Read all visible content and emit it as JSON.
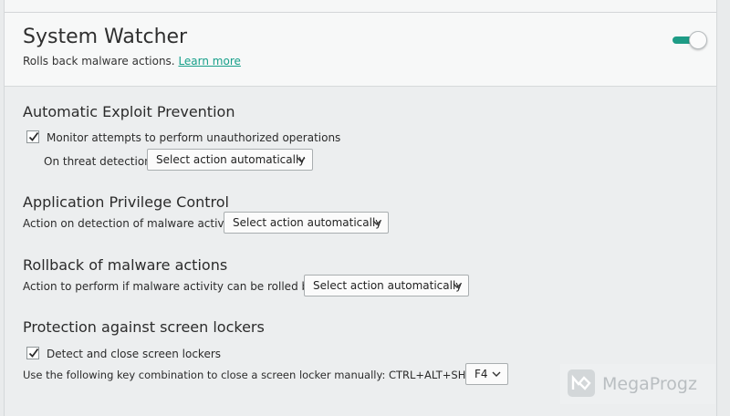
{
  "header": {
    "title": "System Watcher",
    "subtitle": "Rolls back malware actions.",
    "learn_more": "Learn more",
    "toggle_state": "on",
    "accent_color": "#1e9c86"
  },
  "sections": {
    "exploit": {
      "title": "Automatic Exploit Prevention",
      "checkbox_label": "Monitor attempts to perform unauthorized operations",
      "checkbox_checked": true,
      "field_label": "On threat detection:",
      "dropdown_value": "Select action automatically"
    },
    "privilege": {
      "title": "Application Privilege Control",
      "field_label": "Action on detection of malware activity:",
      "dropdown_value": "Select action automatically"
    },
    "rollback": {
      "title": "Rollback of malware actions",
      "field_label": "Action to perform if malware activity can be rolled back:",
      "dropdown_value": "Select action automatically"
    },
    "screen_lockers": {
      "title": "Protection against screen lockers",
      "checkbox_label": "Detect and close screen lockers",
      "checkbox_checked": true,
      "key_label": "Use the following key combination to close a screen locker manually: CTRL+ALT+SHIFT+",
      "key_value": "F4"
    }
  },
  "watermark": {
    "text": "MegaProgz"
  },
  "icons": {
    "checkmark": "checkmark-icon",
    "dropdown": "chevron-down-icon",
    "watermark_logo": "megaprogz-logo"
  }
}
